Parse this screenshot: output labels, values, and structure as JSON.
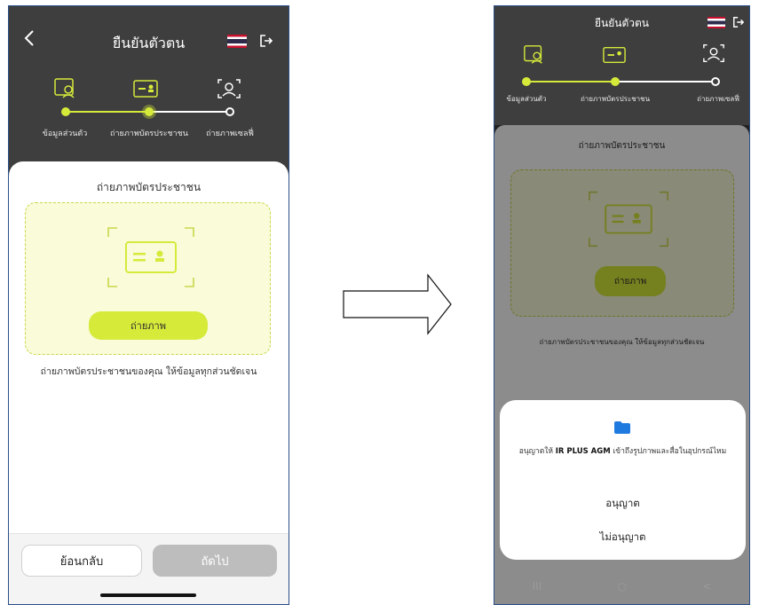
{
  "left_screen": {
    "title": "ยืนยันตัวตน",
    "steps": [
      {
        "label": "ข้อมูลส่วนตัว",
        "state": "done"
      },
      {
        "label": "ถ่ายภาพบัตรประชาชน",
        "state": "current"
      },
      {
        "label": "ถ่ายภาพเซลฟี่",
        "state": "pending"
      }
    ],
    "section_title": "ถ่ายภาพบัตรประชาชน",
    "capture_button": "ถ่ายภาพ",
    "hint": "ถ่ายภาพบัตรประชาชนของคุณ ให้ข้อมูลทุกส่วนชัดเจน",
    "back_button": "ย้อนกลับ",
    "next_button": "ถัดไป"
  },
  "right_screen": {
    "title": "ยืนยันตัวตน",
    "steps": [
      {
        "label": "ข้อมูลส่วนตัว"
      },
      {
        "label": "ถ่ายภาพบัตรประชาชน"
      },
      {
        "label": "ถ่ายภาพเซลฟี่"
      }
    ],
    "section_title": "ถ่ายภาพบัตรประชาชน",
    "capture_button": "ถ่ายภาพ",
    "hint": "ถ่ายภาพบัตรประชาชนของคุณ ให้ข้อมูลทุกส่วนชัดเจน",
    "dialog": {
      "message_prefix": "อนุญาตให้",
      "app_name": "IR PLUS AGM",
      "message_suffix": "เข้าถึงรูปภาพและสื่อในอุปกรณ์ไหม",
      "allow": "อนุญาต",
      "deny": "ไม่อนุญาต"
    },
    "navbar": {
      "recent": "III",
      "home": "○",
      "back": "<"
    }
  },
  "colors": {
    "accent": "#d6ea3a",
    "dark_bg": "#3e3e3e",
    "scan_fill": "#f9fbd9",
    "folder": "#1f7ae0"
  }
}
